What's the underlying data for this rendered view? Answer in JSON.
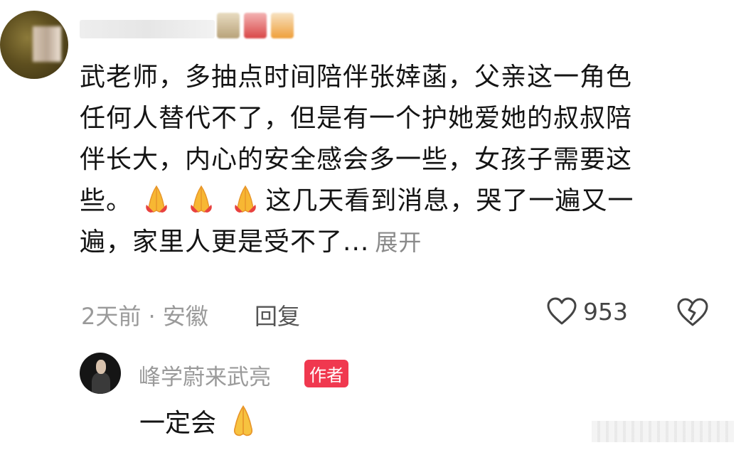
{
  "comment": {
    "lines": [
      "武老师，多抽点时间陪伴张婞菡，父亲这一角色",
      "任何人替代不了，但是有一个护她爱她的叔叔陪",
      "伴长大，内心的安全感会多一些，女孩子需要这"
    ],
    "line4_prefix": "些。",
    "line4_suffix": "这几天看到消息，哭了一遍又一",
    "line5": "遍，家里人更是受不了...",
    "expand_label": "展开"
  },
  "meta": {
    "time_location": "2天前 · 安徽",
    "reply_label": "回复",
    "like_count": "953"
  },
  "author_reply": {
    "name": "峰学蔚来武亮",
    "tag": "作者",
    "text": "一定会"
  },
  "icons": {
    "like": "heart-outline-icon",
    "dislike": "broken-heart-icon",
    "pray": "folded-hands-emoji",
    "like_color": "#444444",
    "tag_color": "#f0384f"
  }
}
